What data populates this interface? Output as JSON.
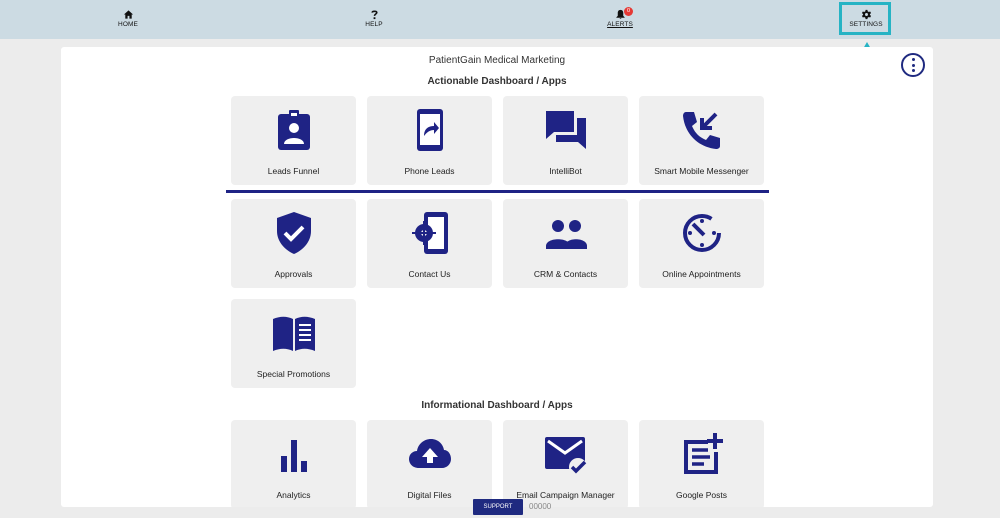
{
  "nav": {
    "items": [
      {
        "label": "HOME",
        "icon": "home-icon"
      },
      {
        "label": "HELP",
        "icon": "question-icon"
      },
      {
        "label": "ALERTS",
        "icon": "bell-icon",
        "badge": "0"
      },
      {
        "label": "SETTINGS",
        "icon": "gear-icon"
      }
    ]
  },
  "panel": {
    "org_name": "PatientGain Medical Marketing",
    "actionable_title": "Actionable Dashboard / Apps",
    "informational_title": "Informational Dashboard / Apps"
  },
  "actionable_apps": [
    {
      "label": "Leads Funnel",
      "icon": "id-badge-icon"
    },
    {
      "label": "Phone Leads",
      "icon": "phone-share-icon"
    },
    {
      "label": "IntelliBot",
      "icon": "chat-bubbles-icon"
    },
    {
      "label": "Smart Mobile Messenger",
      "icon": "phone-callback-icon"
    },
    {
      "label": "Approvals",
      "icon": "shield-check-icon"
    },
    {
      "label": "Contact Us",
      "icon": "phone-settings-icon"
    },
    {
      "label": "CRM & Contacts",
      "icon": "people-icon"
    },
    {
      "label": "Online Appointments",
      "icon": "timer-icon"
    },
    {
      "label": "Special Promotions",
      "icon": "open-book-icon"
    }
  ],
  "informational_apps": [
    {
      "label": "Analytics",
      "icon": "bar-chart-icon"
    },
    {
      "label": "Digital Files",
      "icon": "cloud-upload-icon"
    },
    {
      "label": "Email Campaign Manager",
      "icon": "mail-check-icon"
    },
    {
      "label": "Google Posts",
      "icon": "post-add-icon"
    }
  ],
  "footer": {
    "support_label": "SUPPORT",
    "code": "00000"
  },
  "colors": {
    "accent": "#1f2385",
    "topbar": "#ccdbe3",
    "highlight": "#26b3c4",
    "tile": "#efefef",
    "badge": "#e53935"
  }
}
